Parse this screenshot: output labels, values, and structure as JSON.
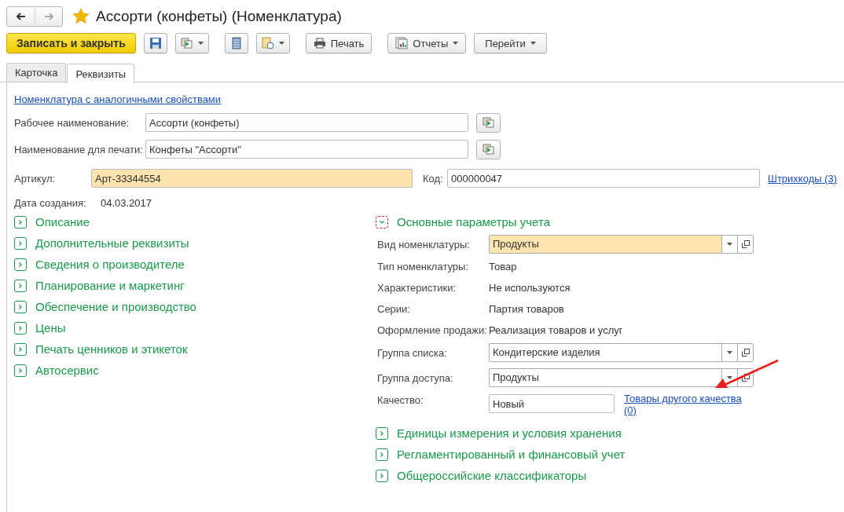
{
  "window": {
    "title": "Ассорти (конфеты) (Номенклатура)",
    "favorite": true
  },
  "toolbar": {
    "primary": "Записать и закрыть",
    "print": "Печать",
    "reports": "Отчеты",
    "goto": "Перейти"
  },
  "tabs": [
    {
      "label": "Карточка",
      "selected": false
    },
    {
      "label": "Реквизиты",
      "selected": true
    }
  ],
  "similar_link": "Номенклатура с аналогичными свойствами",
  "names": [
    {
      "label": "Рабочее наименование:",
      "value": "Ассорти (конфеты)"
    },
    {
      "label": "Наименование для печати:",
      "value": "Конфеты \"Ассорти\""
    }
  ],
  "article": {
    "label": "Артикул:",
    "value": "Арт-33344554",
    "required": true
  },
  "code": {
    "label": "Код:",
    "value": "000000047"
  },
  "barcodes_link": "Штрихкоды (3)",
  "created": {
    "label": "Дата создания:",
    "value": "04.03.2017"
  },
  "left_groups": [
    {
      "title": "Описание",
      "expanded": false
    },
    {
      "title": "Дополнительные реквизиты",
      "expanded": false
    },
    {
      "title": "Сведения о производителе",
      "expanded": false
    },
    {
      "title": "Планирование и маркетинг",
      "expanded": false
    },
    {
      "title": "Обеспечение и производство",
      "expanded": false
    },
    {
      "title": "Цены",
      "expanded": false
    },
    {
      "title": "Печать ценников и этикеток",
      "expanded": false
    },
    {
      "title": "Автосервис",
      "expanded": false
    }
  ],
  "main_group": {
    "title": "Основные параметры учета",
    "expanded": true,
    "rows": [
      {
        "kind": "select",
        "label": "Вид номенклатуры:",
        "value": "Продукты",
        "required": true
      },
      {
        "kind": "text",
        "label": "Тип номенклатуры:",
        "value": "Товар"
      },
      {
        "kind": "text",
        "label": "Характеристики:",
        "value": "Не используются"
      },
      {
        "kind": "text",
        "label": "Серии:",
        "value": "Партия товаров"
      },
      {
        "kind": "text",
        "label": "Оформление продажи:",
        "value": "Реализация товаров и услуг"
      },
      {
        "kind": "select",
        "label": "Группа списка:",
        "value": "Кондитерские изделия",
        "required": false
      },
      {
        "kind": "select",
        "label": "Группа доступа:",
        "value": "Продукты",
        "required": false
      },
      {
        "kind": "input",
        "label": "Качество:",
        "value": "Новый",
        "link": "Товары другого качества (0)"
      }
    ]
  },
  "bottom_groups": [
    {
      "title": "Единицы измерения и условия хранения",
      "expanded": false
    },
    {
      "title": "Регламентированный и финансовый учет",
      "expanded": false
    },
    {
      "title": "Общероссийские классификаторы",
      "expanded": false
    }
  ]
}
